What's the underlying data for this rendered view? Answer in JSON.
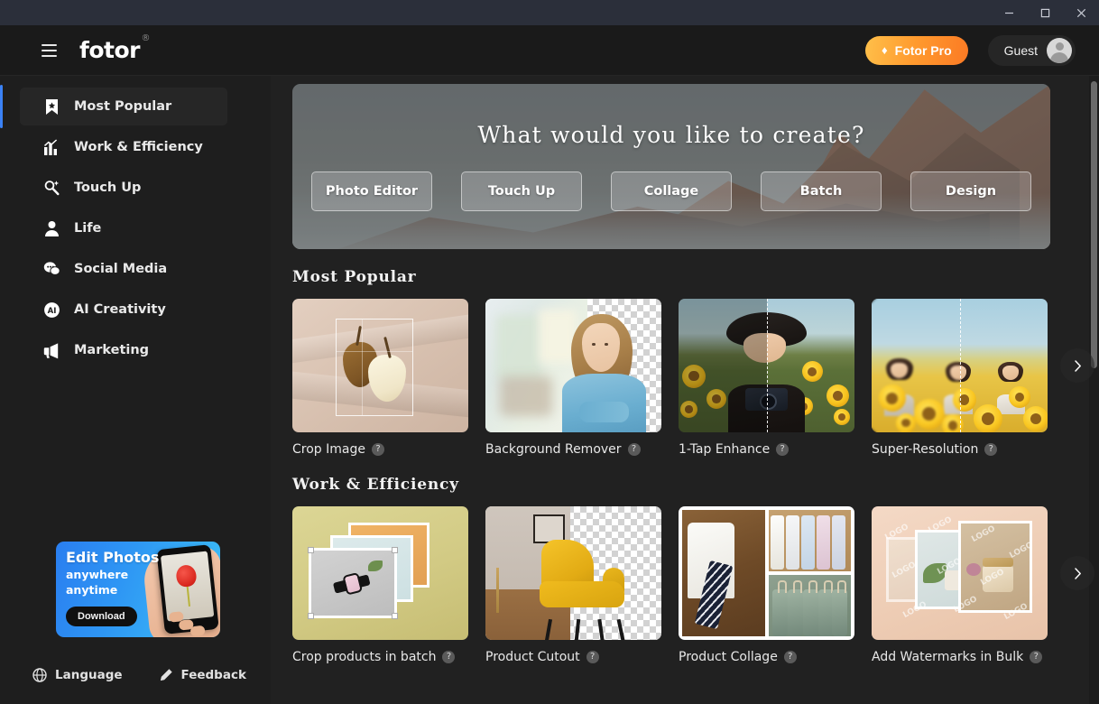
{
  "window": {
    "minimize_label": "–",
    "maximize_label": "□",
    "close_label": "✕"
  },
  "topbar": {
    "menu_icon": "hamburger-icon",
    "logo_text": "fotor",
    "logo_mark": "®",
    "pro_button": {
      "label": "Fotor Pro",
      "icon": "♦",
      "accent": "#ff9a2e"
    },
    "account": {
      "name": "Guest",
      "avatar_icon": "user-avatar"
    }
  },
  "sidebar": {
    "items": [
      {
        "label": "Most Popular",
        "icon": "bookmark-star-icon",
        "active": true
      },
      {
        "label": "Work & Efficiency",
        "icon": "bar-chart-icon",
        "active": false
      },
      {
        "label": "Touch Up",
        "icon": "magic-wand-icon",
        "active": false
      },
      {
        "label": "Life",
        "icon": "person-icon",
        "active": false
      },
      {
        "label": "Social Media",
        "icon": "chat-bubbles-icon",
        "active": false
      },
      {
        "label": "AI Creativity",
        "icon": "ai-circle-icon",
        "active": false
      },
      {
        "label": "Marketing",
        "icon": "megaphone-icon",
        "active": false
      }
    ],
    "promo": {
      "title": "Edit Photos",
      "subtitle_line1": "anywhere",
      "subtitle_line2": "anytime",
      "button_label": "Download"
    },
    "footer": [
      {
        "label": "Language",
        "icon": "globe-icon"
      },
      {
        "label": "Feedback",
        "icon": "pencil-icon"
      }
    ]
  },
  "hero": {
    "title": "What would you like to create?",
    "buttons": [
      {
        "label": "Photo Editor"
      },
      {
        "label": "Touch Up"
      },
      {
        "label": "Collage"
      },
      {
        "label": "Batch"
      },
      {
        "label": "Design"
      }
    ]
  },
  "sections": [
    {
      "title": "Most Popular",
      "next_icon": "chevron-right-icon",
      "cards": [
        {
          "label": "Crop Image",
          "help_icon": "?"
        },
        {
          "label": "Background Remover",
          "help_icon": "?"
        },
        {
          "label": "1-Tap Enhance",
          "help_icon": "?"
        },
        {
          "label": "Super-Resolution",
          "help_icon": "?"
        }
      ]
    },
    {
      "title": "Work & Efficiency",
      "next_icon": "chevron-right-icon",
      "cards": [
        {
          "label": "Crop products in batch",
          "help_icon": "?"
        },
        {
          "label": "Product Cutout",
          "help_icon": "?"
        },
        {
          "label": "Product Collage",
          "help_icon": "?"
        },
        {
          "label": "Add Watermarks in Bulk",
          "help_icon": "?"
        }
      ]
    }
  ],
  "watermark_text": "LOGO"
}
